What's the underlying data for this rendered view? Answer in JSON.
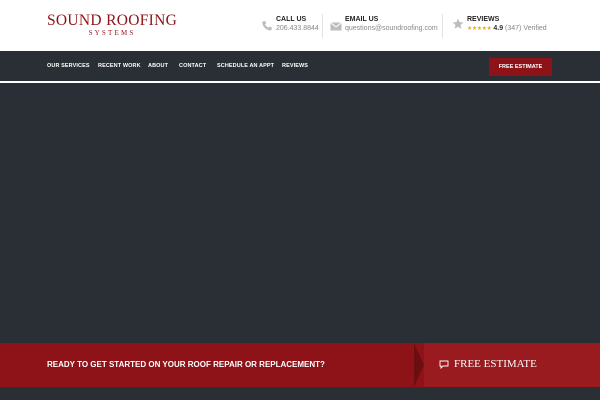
{
  "brand": {
    "name": "SOUND ROOFING",
    "sub": "SYSTEMS",
    "color": "#8e1318"
  },
  "contact": {
    "call": {
      "label": "CALL US",
      "value": "206.433.8844",
      "icon": "phone-icon"
    },
    "email": {
      "label": "EMAIL US",
      "value": "questions@soundroofing.com",
      "icon": "envelope-icon"
    },
    "reviews": {
      "label": "REVIEWS",
      "stars": "★★★★★",
      "score": "4.9",
      "count": "(347)",
      "verified": "Verified",
      "icon": "star-icon"
    }
  },
  "nav": {
    "items": [
      {
        "label": "OUR SERVICES"
      },
      {
        "label": "RECENT WORK"
      },
      {
        "label": "ABOUT"
      },
      {
        "label": "CONTACT"
      },
      {
        "label": "SCHEDULE AN APPT"
      },
      {
        "label": "REVIEWS"
      }
    ],
    "cta_label": "FREE ESTIMATE"
  },
  "cta_bar": {
    "text": "READY TO GET STARTED ON YOUR ROOF REPAIR OR REPLACEMENT?",
    "button_label": "FREE ESTIMATE",
    "button_icon": "chat-bubble-icon"
  },
  "colors": {
    "accent": "#8e1318",
    "dark": "#2a2e35",
    "star": "#f2a91c"
  }
}
